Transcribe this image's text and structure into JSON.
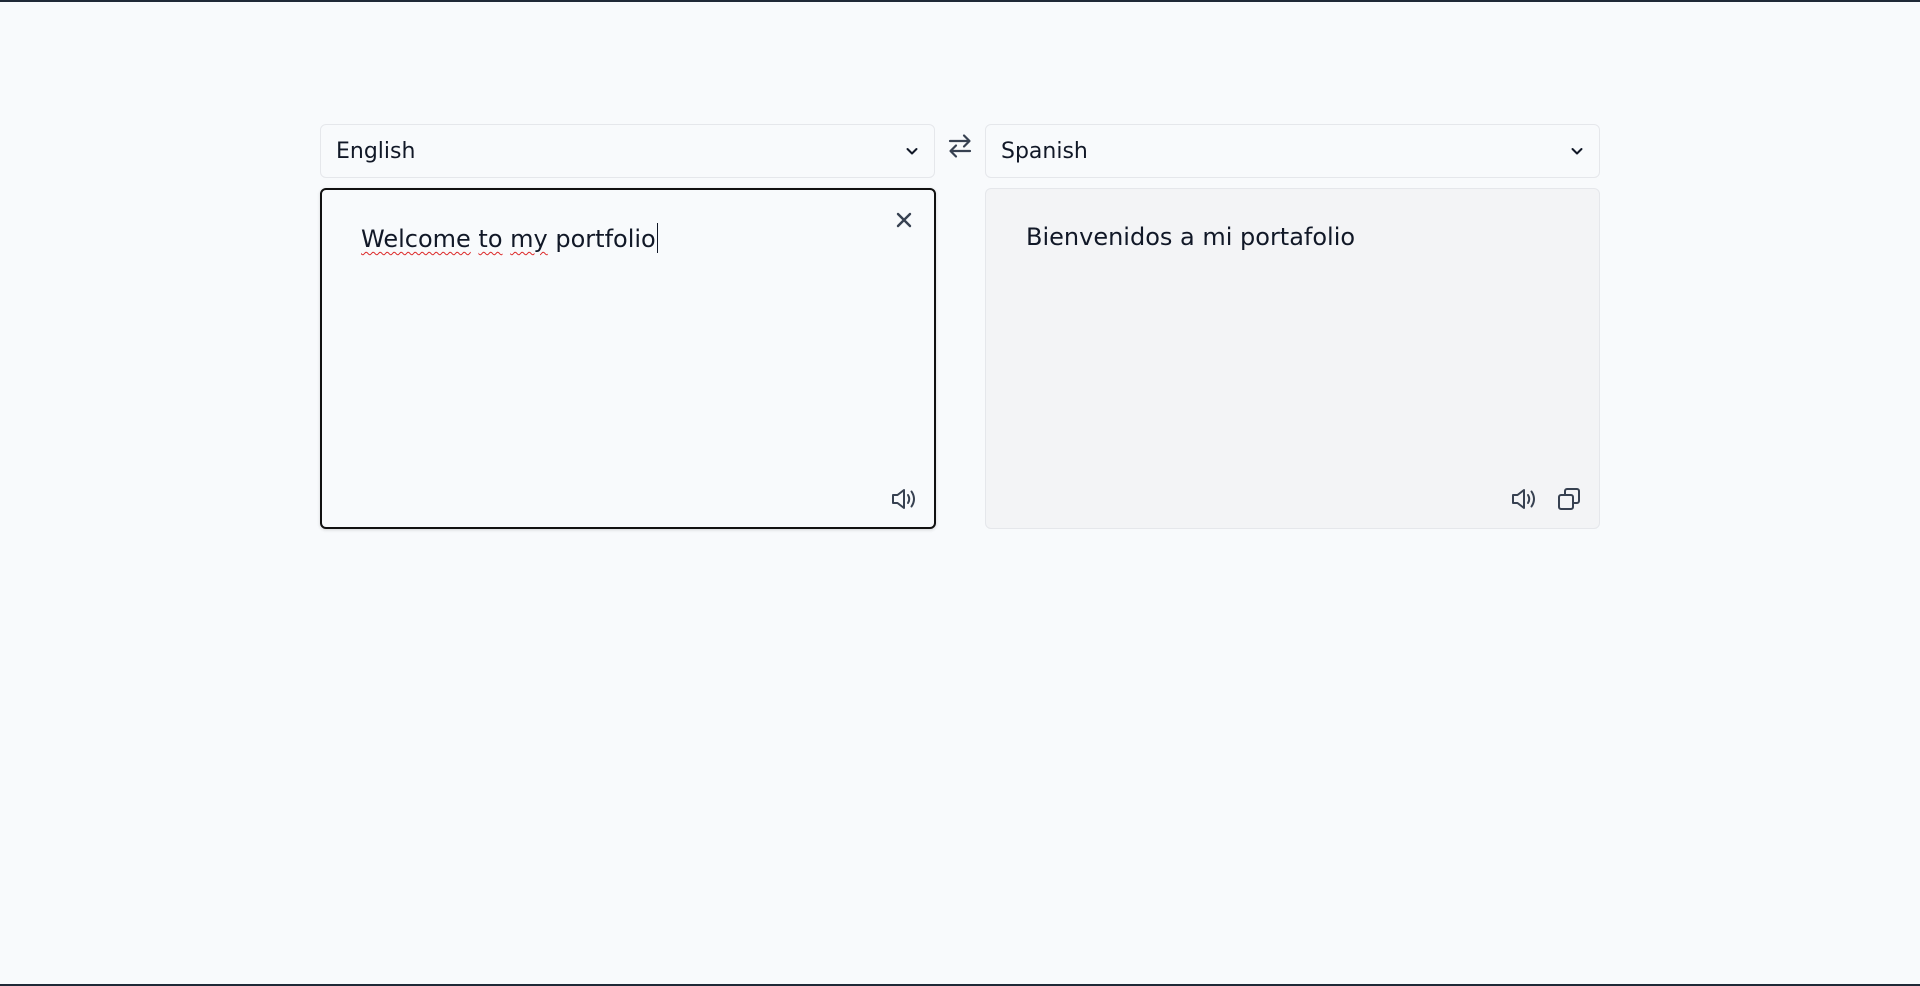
{
  "source_language": {
    "selected": "English",
    "icon": "chevron-down-icon"
  },
  "target_language": {
    "selected": "Spanish",
    "icon": "chevron-down-icon"
  },
  "swap": {
    "icon": "swap-arrows-icon"
  },
  "source_panel": {
    "text_words": [
      "Welcome",
      " ",
      "to",
      " ",
      "my",
      " portfolio"
    ],
    "clear_icon": "close-icon",
    "speaker_icon": "speaker-icon"
  },
  "target_panel": {
    "text": "Bienvenidos a mi portafolio",
    "speaker_icon": "speaker-icon",
    "copy_icon": "copy-icon"
  },
  "colors": {
    "page_background": "#f8fafc",
    "active_border": "#111111",
    "output_background": "#f3f4f6",
    "spellcheck_underline": "#dc2626",
    "text": "#111827"
  }
}
